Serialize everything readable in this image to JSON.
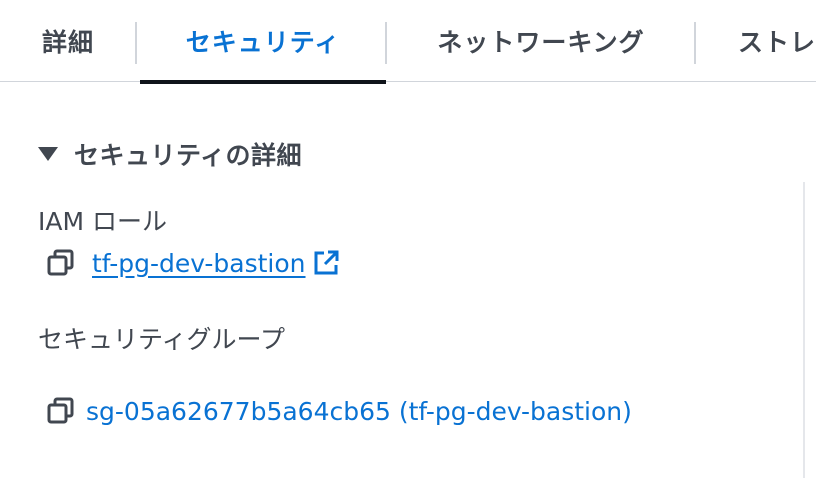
{
  "tabs": {
    "details": "詳細",
    "security": "セキュリティ",
    "networking": "ネットワーキング",
    "storage": "ストレ"
  },
  "section": {
    "title": "セキュリティの詳細",
    "expanded": true
  },
  "iam_role": {
    "label": "IAM ロール",
    "value": "tf-pg-dev-bastion"
  },
  "security_groups": {
    "label": "セキュリティグループ",
    "value": "sg-05a62677b5a64cb65 (tf-pg-dev-bastion)"
  },
  "colors": {
    "link": "#0972d3",
    "active_tab": "#0972d3",
    "text": "#414750"
  },
  "icons": [
    "caret-down-icon",
    "copy-icon",
    "external-link-icon"
  ]
}
